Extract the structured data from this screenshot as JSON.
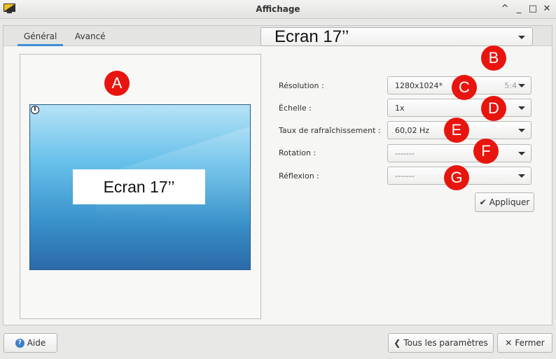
{
  "window": {
    "title": "Affichage",
    "controls": [
      "^",
      "_",
      "□",
      "✕"
    ]
  },
  "tabs": [
    {
      "label": "Général",
      "active": true
    },
    {
      "label": "Avancé",
      "active": false
    }
  ],
  "preview": {
    "monitor_label": "Ecran 17’’",
    "info_icon": "i"
  },
  "screen_selector": {
    "value": "Ecran 17’’"
  },
  "settings": {
    "resolution": {
      "label": "Résolution :",
      "value": "1280x1024*",
      "ratio": "5:4"
    },
    "scale": {
      "label": "Échelle :",
      "value": "1x"
    },
    "refresh": {
      "label": "Taux de rafraîchissement :",
      "value": "60,02 Hz"
    },
    "rotation": {
      "label": "Rotation :",
      "value": "-------"
    },
    "reflection": {
      "label": "Réflexion :",
      "value": "-------"
    }
  },
  "buttons": {
    "apply": "Appliquer",
    "help": "Aide",
    "all_settings": "Tous les paramètres",
    "close": "Fermer"
  },
  "markers": [
    "A",
    "B",
    "C",
    "D",
    "E",
    "F",
    "G"
  ],
  "colors": {
    "accent": "#3b8fd6",
    "marker": "#e8150e"
  }
}
